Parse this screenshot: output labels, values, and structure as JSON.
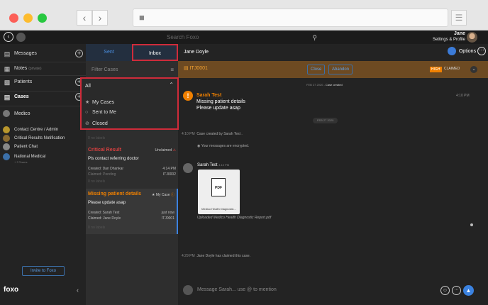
{
  "app": {
    "search_placeholder": "Search Foxo",
    "user_name": "Jane",
    "user_sub": "Settings & Profile"
  },
  "sidebar": {
    "messages": "Messages",
    "notes": "Notes",
    "notes_sub": "(private)",
    "patients": "Patients",
    "cases": "Cases",
    "medico": "Medico",
    "contact_centre": "Contact Centre / Admin",
    "critical_results": "Critical Results Notification",
    "patient_chat": "Patient Chat",
    "national_medical": "National Medical",
    "national_medical_sub": "+ 3 Teams",
    "invite": "Invite to Foxo",
    "logo": "foxo"
  },
  "caselist": {
    "tabs": {
      "sent": "Sent",
      "inbox": "Inbox"
    },
    "filter_placeholder": "Filter Cases",
    "filter_menu": {
      "selected": "All",
      "options": [
        "My Cases",
        "Sent to Me",
        "Closed"
      ]
    },
    "partial_labels": "0 no labels",
    "cards": [
      {
        "title": "Critical Result",
        "tag": "Unclaimed",
        "body": "Pls contact referring doctor",
        "created": "Created: Dan Dhankar",
        "claimed": "Claimed: Pending",
        "time": "4:14 PM",
        "id": "ITJ0002",
        "labels": "0 no labels",
        "color": "#d94040"
      },
      {
        "title": "Missing patient details",
        "tag": "My Case",
        "body": "Please update asap",
        "created": "Created: Sarah Test",
        "claimed": "Claimed: Jane Doyle",
        "time": "just now",
        "id": "ITJ0001",
        "labels": "0 no labels",
        "color": "#f08000"
      }
    ]
  },
  "chat": {
    "title": "Jane Doyle",
    "options": "Options",
    "case_id": "ITJ0001",
    "close": "Close",
    "abandon": "Abandon",
    "priority": "HIGH",
    "status": "CLAIMED",
    "created_pill_date": "FEB 27 2020",
    "created_pill_text": "Case created",
    "alert_sender": "Sarah Test",
    "alert_line1": "Missing patient details",
    "alert_line2": "Please update asap",
    "alert_time": "4:10 PM",
    "date_pill": "FEB 27 2020",
    "sys1_time": "4:10 PM",
    "sys1": "Case created by Sarah Test .",
    "encrypted": "Your messages are encrypted.",
    "msg_sender": "Sarah Test",
    "msg_time": "4:10 PM",
    "doc_name": "Medico Health Diagnostic...",
    "doc_badge": "PDF",
    "upload_text": "Uploaded Medico Health Diagnostic Report.pdf",
    "sys2_time": "4:29 PM",
    "sys2": "Jane Doyle has claimed this case.",
    "composer_placeholder": "Message Sarah... use @ to mention"
  }
}
